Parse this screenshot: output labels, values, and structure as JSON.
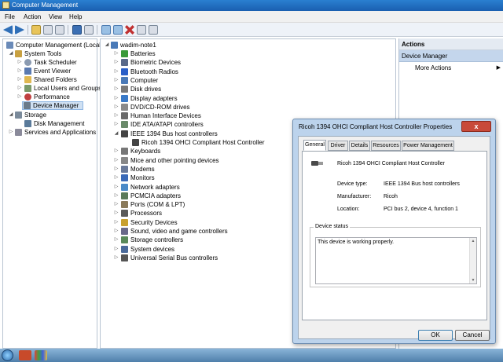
{
  "window": {
    "title": "Computer Management"
  },
  "menu": [
    "File",
    "Action",
    "View",
    "Help"
  ],
  "toolbar_icons": [
    "back-icon",
    "forward-icon",
    "up-folder-icon",
    "show-hide-tree-icon",
    "properties-icon",
    "help-icon",
    "view-icon",
    "update-driver-icon",
    "uninstall-icon",
    "disable-icon",
    "scan-hardware-icon"
  ],
  "tree": {
    "root": "Computer Management (Local",
    "items": [
      {
        "label": "System Tools",
        "level": 1
      },
      {
        "label": "Task Scheduler",
        "level": 2
      },
      {
        "label": "Event Viewer",
        "level": 2
      },
      {
        "label": "Shared Folders",
        "level": 2
      },
      {
        "label": "Local Users and Groups",
        "level": 2
      },
      {
        "label": "Performance",
        "level": 2
      },
      {
        "label": "Device Manager",
        "level": 2,
        "selected": true
      },
      {
        "label": "Storage",
        "level": 1
      },
      {
        "label": "Disk Management",
        "level": 2
      },
      {
        "label": "Services and Applications",
        "level": 1
      }
    ]
  },
  "devices": {
    "computer_name": "wadim-note1",
    "items": [
      {
        "label": "Batteries",
        "icon": "battery-icon",
        "color": "#3a9a3a"
      },
      {
        "label": "Biometric Devices",
        "icon": "biometric-icon",
        "color": "#5a6a8a"
      },
      {
        "label": "Bluetooth Radios",
        "icon": "bluetooth-icon",
        "color": "#2a5fc8"
      },
      {
        "label": "Computer",
        "icon": "computer-icon",
        "color": "#4a7ab8"
      },
      {
        "label": "Disk drives",
        "icon": "disk-drive-icon",
        "color": "#7a7a7a"
      },
      {
        "label": "Display adapters",
        "icon": "display-adapter-icon",
        "color": "#3a7ac8"
      },
      {
        "label": "DVD/CD-ROM drives",
        "icon": "dvd-drive-icon",
        "color": "#8a8a8a"
      },
      {
        "label": "Human Interface Devices",
        "icon": "hid-icon",
        "color": "#6a6a6a"
      },
      {
        "label": "IDE ATA/ATAPI controllers",
        "icon": "ide-controller-icon",
        "color": "#6a8a6a"
      },
      {
        "label": "IEEE 1394 Bus host controllers",
        "icon": "ieee1394-icon",
        "color": "#444444",
        "expanded": true
      },
      {
        "label": "Ricoh 1394 OHCI Compliant Host Controller",
        "icon": "ieee1394-device-icon",
        "color": "#444444",
        "child": true
      },
      {
        "label": "Keyboards",
        "icon": "keyboard-icon",
        "color": "#777777"
      },
      {
        "label": "Mice and other pointing devices",
        "icon": "mouse-icon",
        "color": "#888888"
      },
      {
        "label": "Modems",
        "icon": "modem-icon",
        "color": "#6a7a9a"
      },
      {
        "label": "Monitors",
        "icon": "monitor-icon",
        "color": "#3a6ab8"
      },
      {
        "label": "Network adapters",
        "icon": "network-adapter-icon",
        "color": "#4a8ac8"
      },
      {
        "label": "PCMCIA adapters",
        "icon": "pcmcia-icon",
        "color": "#5a7a5a"
      },
      {
        "label": "Ports (COM & LPT)",
        "icon": "port-icon",
        "color": "#8a7a5a"
      },
      {
        "label": "Processors",
        "icon": "processor-icon",
        "color": "#5a5a5a"
      },
      {
        "label": "Security Devices",
        "icon": "security-device-icon",
        "color": "#c8a030"
      },
      {
        "label": "Sound, video and game controllers",
        "icon": "sound-icon",
        "color": "#6a6a8a"
      },
      {
        "label": "Storage controllers",
        "icon": "storage-controller-icon",
        "color": "#5a8a5a"
      },
      {
        "label": "System devices",
        "icon": "system-device-icon",
        "color": "#4a6a9a"
      },
      {
        "label": "Universal Serial Bus controllers",
        "icon": "usb-icon",
        "color": "#555555"
      }
    ]
  },
  "actions": {
    "header": "Actions",
    "section": "Device Manager",
    "more": "More Actions"
  },
  "dialog": {
    "title": "Ricoh 1394 OHCI Compliant Host Controller Properties",
    "close": "x",
    "tabs": [
      "General",
      "Driver",
      "Details",
      "Resources",
      "Power Management"
    ],
    "device_name": "Ricoh 1394 OHCI Compliant Host Controller",
    "props": [
      {
        "label": "Device type:",
        "value": "IEEE 1394 Bus host controllers"
      },
      {
        "label": "Manufacturer:",
        "value": "Ricoh"
      },
      {
        "label": "Location:",
        "value": "PCI bus 2, device 4, function 1"
      }
    ],
    "status_legend": "Device status",
    "status_text": "This device is working properly.",
    "ok": "OK",
    "cancel": "Cancel"
  }
}
